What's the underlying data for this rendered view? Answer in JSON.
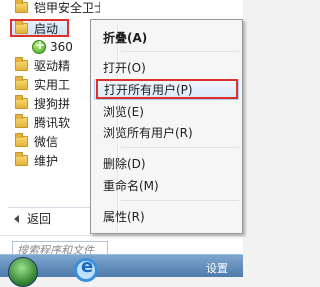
{
  "start_menu": {
    "programs": [
      {
        "label": "铠甲安全卫士",
        "icon": "folder-icon"
      },
      {
        "label": "启动",
        "icon": "folder-icon",
        "selected": true
      },
      {
        "label": "360",
        "icon": "app-360-icon"
      },
      {
        "label": "驱动精",
        "icon": "folder-icon"
      },
      {
        "label": "实用工",
        "icon": "folder-icon"
      },
      {
        "label": "搜狗拼",
        "icon": "folder-icon"
      },
      {
        "label": "腾讯软",
        "icon": "folder-icon"
      },
      {
        "label": "微信",
        "icon": "folder-icon"
      },
      {
        "label": "维护",
        "icon": "folder-icon"
      }
    ],
    "back_label": "返回",
    "search_placeholder": "搜索程序和文件"
  },
  "context_menu": {
    "items": [
      {
        "label": "折叠(A)",
        "bold": true
      },
      {
        "label": "打开(O)"
      },
      {
        "label": "打开所有用户(P)",
        "highlighted": true
      },
      {
        "label": "浏览(E)"
      },
      {
        "label": "浏览所有用户(R)"
      },
      {
        "label": "删除(D)"
      },
      {
        "label": "重命名(M)"
      },
      {
        "label": "属性(R)"
      }
    ]
  },
  "taskbar": {
    "task_text": "设置"
  },
  "colors": {
    "highlight_outline": "#e0302c",
    "folder": "#e3b33c",
    "taskbar": "#5d88b8"
  }
}
